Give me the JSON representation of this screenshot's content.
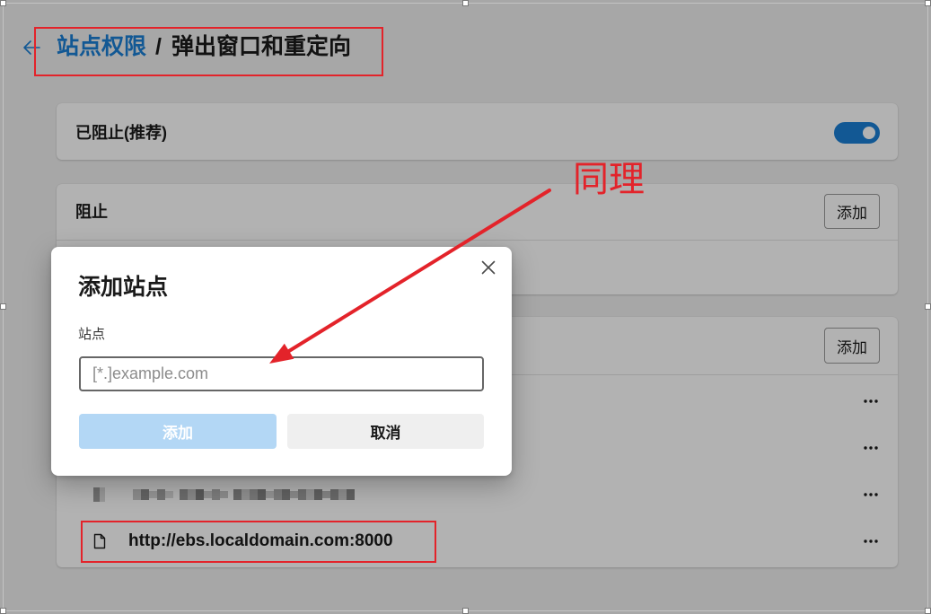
{
  "colors": {
    "accent": "#1a7fd4",
    "annotation": "#e3232a",
    "primary_disabled": "#b3d7f5",
    "secondary_button": "#efefef"
  },
  "icons": {
    "back": "arrow-left-icon",
    "close": "close-icon",
    "more": "more-horizontal-icon",
    "file": "file-icon"
  },
  "header": {
    "parent_label": "站点权限",
    "separator": "/",
    "title": "弹出窗口和重定向"
  },
  "blocked_toggle": {
    "label": "已阻止(推荐)",
    "on": true
  },
  "block_section": {
    "title": "阻止",
    "add_label": "添加"
  },
  "allow_section": {
    "add_label": "添加",
    "items": [
      {
        "menu_icon": "more-horizontal-icon"
      },
      {
        "menu_icon": "more-horizontal-icon"
      },
      {
        "redacted": true,
        "menu_icon": "more-horizontal-icon"
      },
      {
        "icon": "file-icon",
        "url": "http://ebs.localdomain.com:8000",
        "menu_icon": "more-horizontal-icon"
      }
    ]
  },
  "dialog": {
    "title": "添加站点",
    "field_label": "站点",
    "site_input": {
      "value": "",
      "placeholder": "[*.]example.com"
    },
    "add_label": "添加",
    "cancel_label": "取消"
  },
  "annotation": {
    "note_text": "同理"
  }
}
